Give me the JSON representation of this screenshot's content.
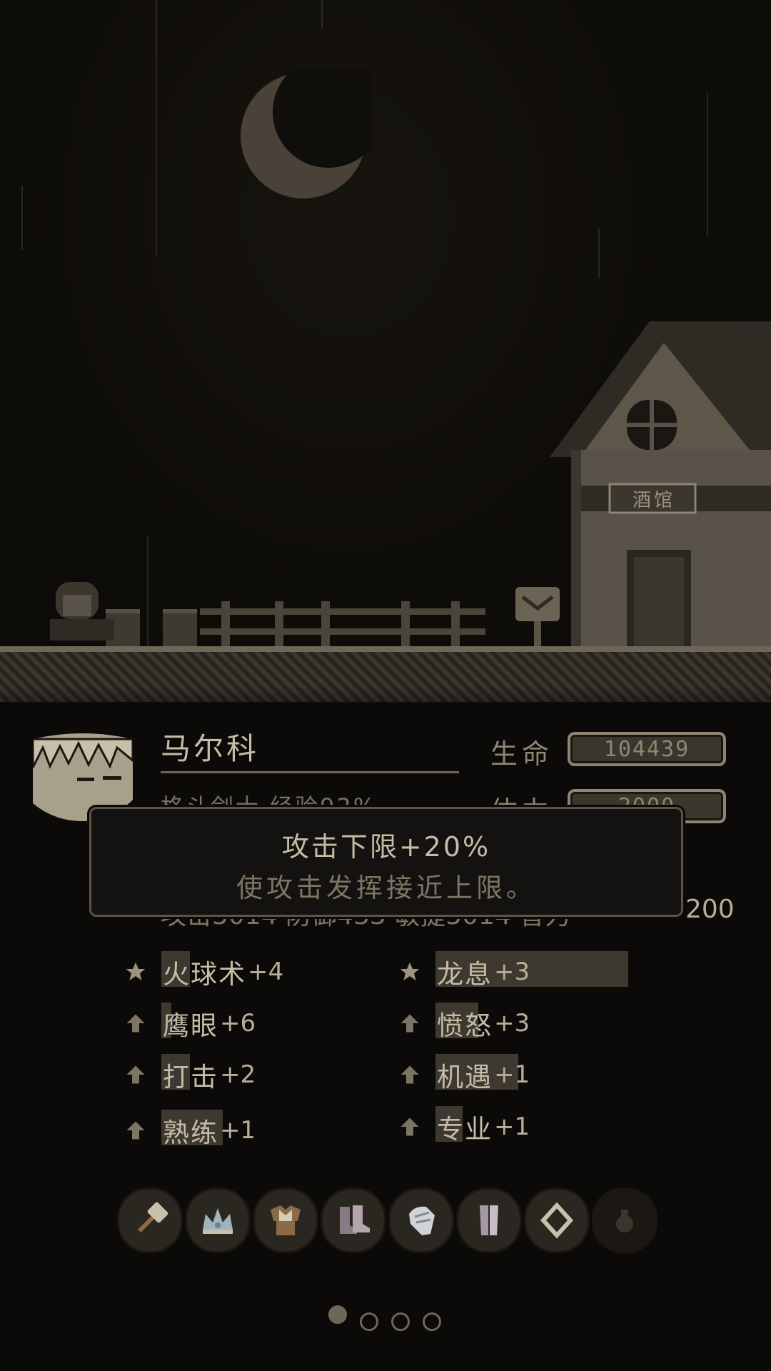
{
  "scene": {
    "building_sign": "酒馆"
  },
  "character": {
    "name": "马尔科",
    "subtitle": "格斗剑士 经验92%"
  },
  "stats": [
    {
      "label": "生命",
      "value": "104439"
    },
    {
      "label": "体力",
      "value": "2000"
    }
  ],
  "hidden_stats_line": {
    "text": "攻击5014  防御433  敏捷5014  智力",
    "last_value": "200"
  },
  "tooltip": {
    "title": "攻击下限+20%",
    "description": "使攻击发挥接近上限。"
  },
  "skills": [
    {
      "name": "火球术",
      "bonus": "+4",
      "icon": "star-icon",
      "selected": false
    },
    {
      "name": "龙息",
      "bonus": "+3",
      "icon": "star-icon",
      "selected": true
    },
    {
      "name": "鹰眼",
      "bonus": "+6",
      "icon": "arrow-up-icon",
      "selected": false
    },
    {
      "name": "愤怒",
      "bonus": "+3",
      "icon": "arrow-up-icon",
      "selected": false
    },
    {
      "name": "打击",
      "bonus": "+2",
      "icon": "arrow-up-icon",
      "selected": false
    },
    {
      "name": "机遇",
      "bonus": "+1",
      "icon": "arrow-up-icon",
      "selected": false
    },
    {
      "name": "熟练",
      "bonus": "+1",
      "icon": "arrow-up-icon",
      "selected": false
    },
    {
      "name": "专业",
      "bonus": "+1",
      "icon": "arrow-up-icon",
      "selected": false
    }
  ],
  "equipment": [
    {
      "icon": "hammer-icon"
    },
    {
      "icon": "crown-icon"
    },
    {
      "icon": "chest-armor-icon"
    },
    {
      "icon": "boots-icon"
    },
    {
      "icon": "gauntlet-icon"
    },
    {
      "icon": "leg-armor-icon"
    },
    {
      "icon": "ring-icon"
    },
    {
      "icon": "empty-slot-icon"
    }
  ],
  "pagination": {
    "pages": 4,
    "current": 1
  },
  "colors": {
    "background": "#0b0a08",
    "text": "#c6bca6",
    "muted": "#7d7564",
    "frame": "#8e8572"
  }
}
